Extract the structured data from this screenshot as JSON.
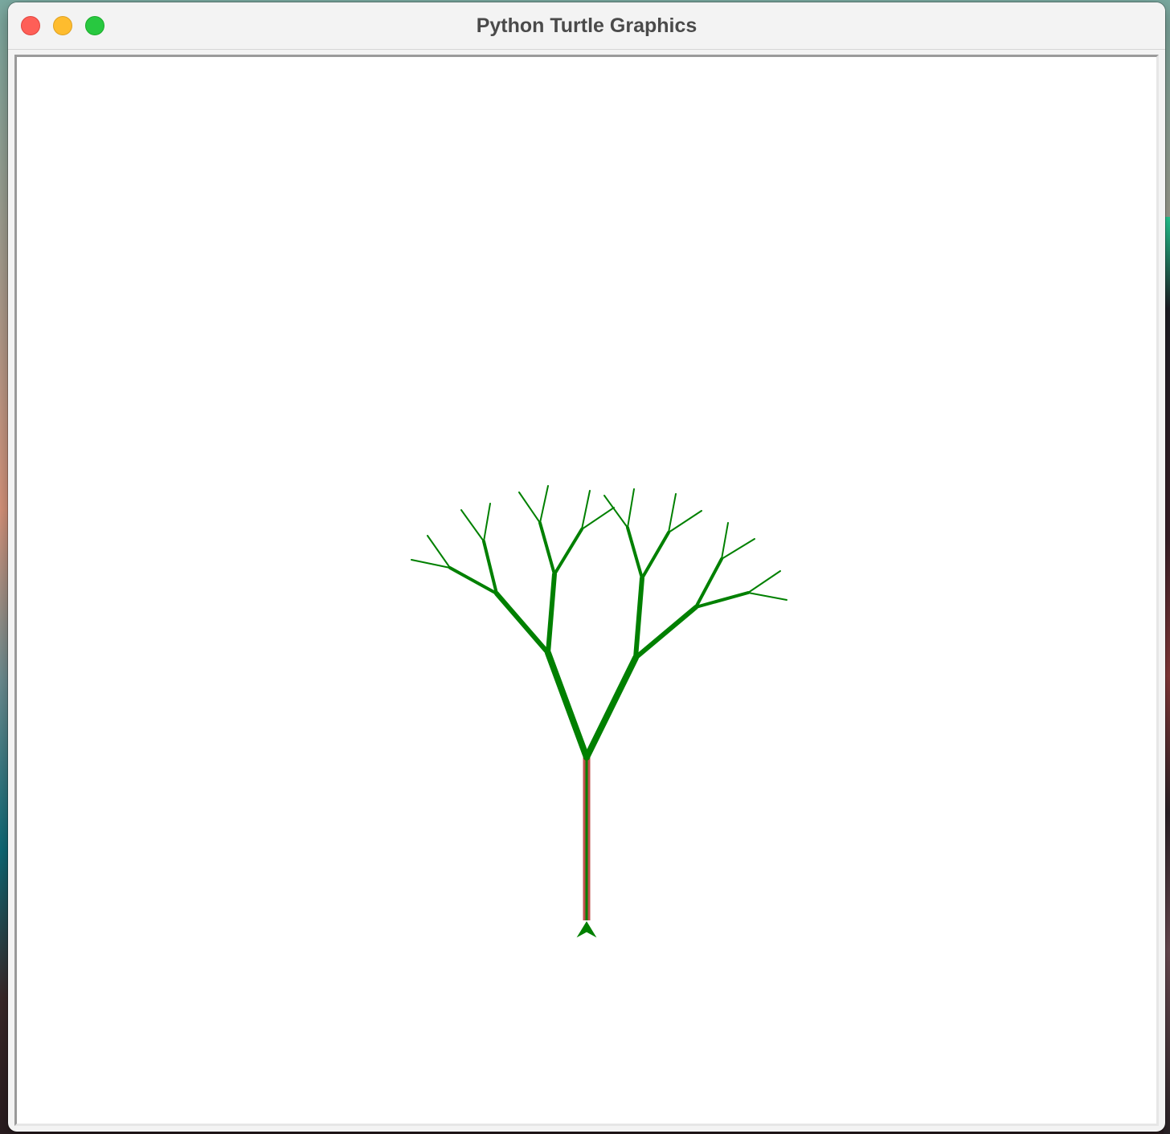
{
  "window": {
    "title": "Python Turtle Graphics",
    "controls": [
      "close",
      "minimize",
      "zoom"
    ]
  },
  "canvas": {
    "background": "#ffffff",
    "drawing": "fractal-tree",
    "colors": {
      "branch": "#008000",
      "trunk_outline": "#c0504d",
      "trunk_fill": "#008000",
      "turtle": "#008000"
    },
    "turtle": {
      "shape": "classic-arrow",
      "heading": "up"
    }
  },
  "icons": {
    "close": "close-circle-icon",
    "minimize": "minimize-circle-icon",
    "zoom": "zoom-circle-icon",
    "turtle": "turtle-arrow-icon"
  }
}
